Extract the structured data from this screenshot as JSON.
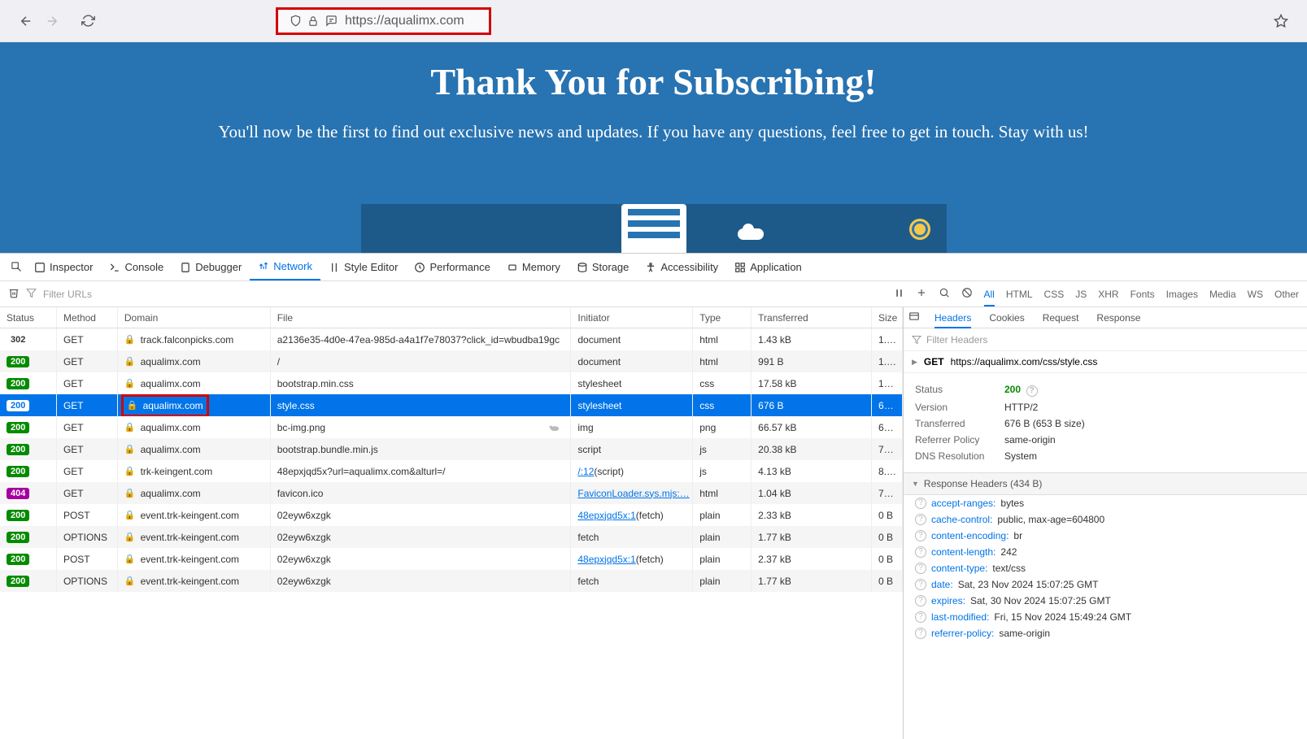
{
  "browser": {
    "url": "https://aqualimx.com"
  },
  "page": {
    "title": "Thank You for Subscribing!",
    "subtitle": "You'll now be the first to find out exclusive news and updates. If you have any questions, feel free to get in touch. Stay with us!"
  },
  "devtools_tabs": [
    "Inspector",
    "Console",
    "Debugger",
    "Network",
    "Style Editor",
    "Performance",
    "Memory",
    "Storage",
    "Accessibility",
    "Application"
  ],
  "active_devtools_tab": "Network",
  "filter_placeholder": "Filter URLs",
  "filter_types": [
    "All",
    "HTML",
    "CSS",
    "JS",
    "XHR",
    "Fonts",
    "Images",
    "Media",
    "WS",
    "Other"
  ],
  "active_filter": "All",
  "columns": [
    "Status",
    "Method",
    "Domain",
    "File",
    "Initiator",
    "Type",
    "Transferred",
    "Size"
  ],
  "rows": [
    {
      "status": "302",
      "method": "GET",
      "domain": "track.falconpicks.com",
      "file": "a2136e35-4d0e-47ea-985d-a4a1f7e78037?click_id=wbudba19gc",
      "initiator": "document",
      "type": "html",
      "transferred": "1.43 kB",
      "size": "1.…"
    },
    {
      "status": "200",
      "method": "GET",
      "domain": "aqualimx.com",
      "file": "/",
      "initiator": "document",
      "type": "html",
      "transferred": "991 B",
      "size": "1.…"
    },
    {
      "status": "200",
      "method": "GET",
      "domain": "aqualimx.com",
      "file": "bootstrap.min.css",
      "initiator": "stylesheet",
      "type": "css",
      "transferred": "17.58 kB",
      "size": "1…"
    },
    {
      "status": "200",
      "method": "GET",
      "domain": "aqualimx.com",
      "file": "style.css",
      "initiator": "stylesheet",
      "type": "css",
      "transferred": "676 B",
      "size": "6…",
      "selected": true,
      "highlighted": true
    },
    {
      "status": "200",
      "method": "GET",
      "domain": "aqualimx.com",
      "file": "bc-img.png",
      "initiator": "img",
      "type": "png",
      "transferred": "66.57 kB",
      "size": "6…",
      "slow": true
    },
    {
      "status": "200",
      "method": "GET",
      "domain": "aqualimx.com",
      "file": "bootstrap.bundle.min.js",
      "initiator": "script",
      "type": "js",
      "transferred": "20.38 kB",
      "size": "7…"
    },
    {
      "status": "200",
      "method": "GET",
      "domain": "trk-keingent.com",
      "file": "48epxjqd5x?url=aqualimx.com&alturl=/",
      "initiator": "/:12 (script)",
      "initiator_link": "/:12",
      "type": "js",
      "transferred": "4.13 kB",
      "size": "8.…"
    },
    {
      "status": "404",
      "method": "GET",
      "domain": "aqualimx.com",
      "file": "favicon.ico",
      "initiator": "FaviconLoader.sys.mjs:…",
      "initiator_link": "FaviconLoader.sys.mjs:…",
      "type": "html",
      "transferred": "1.04 kB",
      "size": "7…"
    },
    {
      "status": "200",
      "method": "POST",
      "domain": "event.trk-keingent.com",
      "file": "02eyw6xzgk",
      "initiator": "48epxjqd5x:1 (fetch)",
      "initiator_link": "48epxjqd5x:1",
      "type": "plain",
      "transferred": "2.33 kB",
      "size": "0 B"
    },
    {
      "status": "200",
      "method": "OPTIONS",
      "domain": "event.trk-keingent.com",
      "file": "02eyw6xzgk",
      "initiator": "fetch",
      "type": "plain",
      "transferred": "1.77 kB",
      "size": "0 B"
    },
    {
      "status": "200",
      "method": "POST",
      "domain": "event.trk-keingent.com",
      "file": "02eyw6xzgk",
      "initiator": "48epxjqd5x:1 (fetch)",
      "initiator_link": "48epxjqd5x:1",
      "type": "plain",
      "transferred": "2.37 kB",
      "size": "0 B"
    },
    {
      "status": "200",
      "method": "OPTIONS",
      "domain": "event.trk-keingent.com",
      "file": "02eyw6xzgk",
      "initiator": "fetch",
      "type": "plain",
      "transferred": "1.77 kB",
      "size": "0 B"
    }
  ],
  "sidebar": {
    "tabs": [
      "Headers",
      "Cookies",
      "Request",
      "Response"
    ],
    "active_tab": "Headers",
    "filter_placeholder": "Filter Headers",
    "method": "GET",
    "url": "https://aqualimx.com/css/style.css",
    "summary": {
      "Status": "200",
      "Version": "HTTP/2",
      "Transferred": "676 B (653 B size)",
      "Referrer Policy": "same-origin",
      "DNS Resolution": "System"
    },
    "response_headers_title": "Response Headers (434 B)",
    "response_headers": [
      {
        "k": "accept-ranges:",
        "v": "bytes"
      },
      {
        "k": "cache-control:",
        "v": "public, max-age=604800"
      },
      {
        "k": "content-encoding:",
        "v": "br"
      },
      {
        "k": "content-length:",
        "v": "242"
      },
      {
        "k": "content-type:",
        "v": "text/css"
      },
      {
        "k": "date:",
        "v": "Sat, 23 Nov 2024 15:07:25 GMT"
      },
      {
        "k": "expires:",
        "v": "Sat, 30 Nov 2024 15:07:25 GMT"
      },
      {
        "k": "last-modified:",
        "v": "Fri, 15 Nov 2024 15:49:24 GMT"
      },
      {
        "k": "referrer-policy:",
        "v": "same-origin"
      }
    ]
  }
}
